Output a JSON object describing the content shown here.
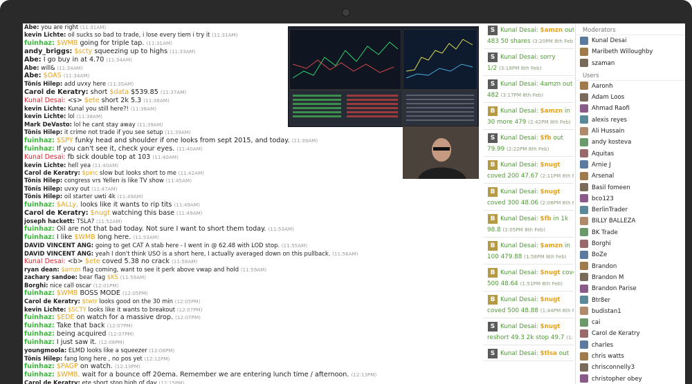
{
  "chat": [
    {
      "nick": "Abe:",
      "nc": "",
      "pre": "",
      "tk": "",
      "text": "you are right",
      "time": "(11:31AM)"
    },
    {
      "nick": "kevin Lichte:",
      "nc": "",
      "pre": "",
      "tk": "",
      "text": "oil sucks so bad to trade, i lose every tiem i try it",
      "time": "(11:31AM)"
    },
    {
      "nick": "fuinhaz:",
      "nc": "green",
      "pre": "",
      "tk": "$WMB",
      "text": "going for triple tap.",
      "time": "(11:31AM)",
      "big": true
    },
    {
      "nick": "andy_briggs:",
      "nc": "",
      "pre": "",
      "tk": "$scty",
      "text": "squeezing up to highs",
      "time": "(11:33AM)",
      "big": true
    },
    {
      "nick": "Abe:",
      "nc": "",
      "pre": "",
      "tk": "",
      "text": "I go buy in at 4.70",
      "time": "(11:34AM)",
      "big": true
    },
    {
      "nick": "Abe:",
      "nc": "",
      "pre": "",
      "tk": "",
      "text": "will&",
      "time": "(11:34AM)"
    },
    {
      "nick": "Abe:",
      "nc": "",
      "pre": "",
      "tk": "$OAS",
      "text": "",
      "time": "(11:34AM)",
      "big": true
    },
    {
      "nick": "Tõnis Hilep:",
      "nc": "",
      "pre": "",
      "tk": "",
      "text": "add uvxy here",
      "time": "(11:35AM)"
    },
    {
      "nick": "Carol de Keratry:",
      "nc": "",
      "pre": "short",
      "tk": "$data",
      "text": "$539.85",
      "time": "(11:37AM)",
      "big": true
    },
    {
      "nick": "Kunal Desai:",
      "nc": "red",
      "pre": "<s>",
      "tk": "$ete",
      "text": "short 2k 5.3",
      "time": "(11:38AM)",
      "big": true
    },
    {
      "nick": "kevin Lichte:",
      "nc": "",
      "pre": "",
      "tk": "",
      "text": "Kunal you still here?!",
      "time": "(11:38AM)"
    },
    {
      "nick": "kevin Lichte:",
      "nc": "",
      "pre": "",
      "tk": "",
      "text": "lol",
      "time": "(11:38AM)"
    },
    {
      "nick": "Mark DeVasto:",
      "nc": "",
      "pre": "",
      "tk": "",
      "text": "lol he cant stay away",
      "time": "(11:39AM)"
    },
    {
      "nick": "Tõnis Hilep:",
      "nc": "",
      "pre": "",
      "tk": "",
      "text": "it crime not trade if you see setup",
      "time": "(11:39AM)"
    },
    {
      "nick": "fuinhaz:",
      "nc": "green",
      "pre": "",
      "tk": "$SPY",
      "text": "funky head and shoulder if one looks from sept 2015, and today.",
      "time": "(11:39AM)",
      "big": true
    },
    {
      "nick": "fuinhaz:",
      "nc": "green",
      "pre": "",
      "tk": "",
      "text": "If you can't see it, check your eyes.",
      "time": "(11:40AM)",
      "big": true
    },
    {
      "nick": "Kunal Desai:",
      "nc": "red",
      "pre": "",
      "tk": "",
      "text": "fb sick double top at 103",
      "time": "(11:40AM)",
      "big": true
    },
    {
      "nick": "kevin Lichte:",
      "nc": "",
      "pre": "",
      "tk": "",
      "text": "hell yea",
      "time": "(11:40AM)"
    },
    {
      "nick": "Carol de Keratry:",
      "nc": "",
      "pre": "",
      "tk": "$pinc",
      "text": "slow but looks short to me",
      "time": "(11:42AM)"
    },
    {
      "nick": "Tõnis Hilep:",
      "nc": "",
      "pre": "",
      "tk": "",
      "text": "congress vrs Yellen is like TV show",
      "time": "(11:45AM)"
    },
    {
      "nick": "Tõnis Hilep:",
      "nc": "",
      "pre": "",
      "tk": "",
      "text": "uvxy out",
      "time": "(11:47AM)"
    },
    {
      "nick": "Tõnis Hilep:",
      "nc": "",
      "pre": "",
      "tk": "",
      "text": "oil starter uwti 4k",
      "time": "(11:49AM)"
    },
    {
      "nick": "fuinhaz:",
      "nc": "green",
      "pre": "",
      "tk": "$ALLy,",
      "text": "looks like it wants to rip tits",
      "time": "(11:49AM)",
      "big": true
    },
    {
      "nick": "Carol de Keratry:",
      "nc": "",
      "pre": "",
      "tk": "$nugt",
      "text": "watching this base",
      "time": "(11:49AM)",
      "big": true
    },
    {
      "nick": "joseph hackett:",
      "nc": "",
      "pre": "",
      "tk": "",
      "text": "TSLA?",
      "time": "(11:52AM)"
    },
    {
      "nick": "fuinhaz:",
      "nc": "green",
      "pre": "",
      "tk": "",
      "text": "Oil are not that bad today. Not sure I want to short them today.",
      "time": "(11:53AM)",
      "big": true
    },
    {
      "nick": "fuinhaz:",
      "nc": "green",
      "pre": "I like",
      "tk": "$WMB",
      "text": "long here.",
      "time": "(11:53AM)",
      "big": true
    },
    {
      "nick": "DAVID VINCENT ANG:",
      "nc": "",
      "pre": "",
      "tk": "",
      "text": "going to get CAT A stab here - I went in @ 62.48 with LOD stop.",
      "time": "(11:55AM)"
    },
    {
      "nick": "DAVID VINCENT ANG:",
      "nc": "",
      "pre": "",
      "tk": "",
      "text": "yeah I don't think USO is a short here, I actually averaged down on this pullback.",
      "time": "(11:56AM)"
    },
    {
      "nick": "Kunal Desai:",
      "nc": "red",
      "pre": "<b>",
      "tk": "$ete",
      "text": "coved 5.38 no crack",
      "time": "(11:58AM)",
      "big": true
    },
    {
      "nick": "ryan dean:",
      "nc": "",
      "pre": "",
      "tk": "$amzn",
      "text": "flag coming, want to see it perk above vwap and hold",
      "time": "(11:59AM)"
    },
    {
      "nick": "zachary sandoe:",
      "nc": "",
      "pre": "bear flag",
      "tk": "$KS",
      "text": "",
      "time": "(11:59AM)"
    },
    {
      "nick": "Borghi:",
      "nc": "",
      "pre": "",
      "tk": "",
      "text": "nice call oscar",
      "time": "(12:01PM)"
    },
    {
      "nick": "fuinhaz:",
      "nc": "green",
      "pre": "",
      "tk": "$WMB",
      "text": "BOSS MODE",
      "time": "(12:05PM)",
      "big": true
    },
    {
      "nick": "Carol de Keratry:",
      "nc": "",
      "pre": "",
      "tk": "$twtr",
      "text": "looks good on the 30 min",
      "time": "(12:05PM)"
    },
    {
      "nick": "kevin Lichte:",
      "nc": "",
      "pre": "",
      "tk": "$SCTY",
      "text": "looks like it wants to breakout",
      "time": "(12:07PM)"
    },
    {
      "nick": "fuinhaz:",
      "nc": "green",
      "pre": "",
      "tk": "$EDE",
      "text": "on watch for a massive drop.",
      "time": "(12:07PM)",
      "big": true
    },
    {
      "nick": "fuinhaz:",
      "nc": "green",
      "pre": "",
      "tk": "",
      "text": "Take that back",
      "time": "(12:07PM)",
      "big": true
    },
    {
      "nick": "fuinhaz:",
      "nc": "green",
      "pre": "",
      "tk": "",
      "text": "being acquired",
      "time": "(12:07PM)",
      "big": true
    },
    {
      "nick": "fuinhaz:",
      "nc": "green",
      "pre": "",
      "tk": "",
      "text": "I just saw it.",
      "time": "(12:08PM)",
      "big": true
    },
    {
      "nick": "youngmoola:",
      "nc": "",
      "pre": "",
      "tk": "",
      "text": "ELMD looks like a squeezer",
      "time": "(12:08PM)"
    },
    {
      "nick": "Tõnis Hilep:",
      "nc": "",
      "pre": "",
      "tk": "",
      "text": "fang long here , no pos yet",
      "time": "(12:12PM)"
    },
    {
      "nick": "fuinhaz:",
      "nc": "green",
      "pre": "",
      "tk": "$PAGP",
      "text": "on watch.",
      "time": "(12:13PM)",
      "big": true
    },
    {
      "nick": "fuinhaz:",
      "nc": "green",
      "pre": "",
      "tk": "$WMB,",
      "text": "wait for a bounce off 20ema. Remember we are entering lunch time / afternoon.",
      "time": "(12:13PM)",
      "big": true
    },
    {
      "nick": "Carol de Keratry:",
      "nc": "",
      "pre": "",
      "tk": "",
      "text": "ete short stop high of day",
      "time": "(12:15PM)"
    }
  ],
  "alerts": [
    {
      "av": "S",
      "ac": "s",
      "who": "Kunal Desai:",
      "tk": "$amzn",
      "tail": "out",
      "l2": "483 50 shares",
      "time": "(3:20PM 8th Feb)"
    },
    {
      "av": "S",
      "ac": "s",
      "who": "Kunal Desai:",
      "tk": "",
      "tail": "sorry",
      "l2": "1/2",
      "time": "(3:18PM 8th Feb)"
    },
    {
      "av": "S",
      "ac": "s",
      "who": "Kunal Desai:",
      "tk": "",
      "tail": "4amzn out",
      "l2": "482",
      "time": "(3:17PM 8th Feb)"
    },
    {
      "av": "B",
      "ac": "b",
      "who": "Kunal Desai:",
      "tk": "$amzn",
      "tail": "in",
      "l2": "30 more 479",
      "time": "(2:42PM 8th Feb)"
    },
    {
      "av": "S",
      "ac": "s",
      "who": "Kunal Desai:",
      "tk": "$fb",
      "tail": "out",
      "l2": "79.99",
      "time": "(2:22PM 8th Feb)"
    },
    {
      "av": "B",
      "ac": "b",
      "who": "Kunal Desai:",
      "tk": "$nugt",
      "tail": "",
      "l2": "coved 200 47.67",
      "time": "(2:11PM 8th Feb)"
    },
    {
      "av": "B",
      "ac": "b",
      "who": "Kunal Desai:",
      "tk": "$nugt",
      "tail": "",
      "l2": "coved 300 48.06",
      "time": "(2:08PM 8th Feb)"
    },
    {
      "av": "B",
      "ac": "b",
      "who": "Kunal Desai:",
      "tk": "$fb",
      "tail": "in 1k",
      "l2": "98.8",
      "time": "(2:05PM 8th Feb)"
    },
    {
      "av": "B",
      "ac": "b",
      "who": "Kunal Desai:",
      "tk": "$amzn",
      "tail": "in",
      "l2": "100 479.88",
      "time": "(1:58PM 8th Feb)"
    },
    {
      "av": "B",
      "ac": "b",
      "who": "Kunal Desai:",
      "tk": "$nugt",
      "tail": "cove",
      "l2": "500 48.64",
      "time": "(1:51PM 8th Feb)"
    },
    {
      "av": "B",
      "ac": "b",
      "who": "Kunal Desai:",
      "tk": "$nugt",
      "tail": "",
      "l2": "coved 500 48.88",
      "time": "(1:44PM 8th Feb)"
    },
    {
      "av": "S",
      "ac": "s",
      "who": "Kunal Desai:",
      "tk": "$nugt",
      "tail": "",
      "l2": "reshort 49.3 2k stop 49.7",
      "time": "(1:39PM 8th Feb)"
    },
    {
      "av": "S",
      "ac": "s",
      "who": "Kunal Desai:",
      "tk": "$tlsa",
      "tail": "out",
      "l2": "",
      "time": ""
    }
  ],
  "moderators_label": "Moderators",
  "moderators": [
    "Kunal Desai",
    "Maribeth Willoughby",
    "szaman"
  ],
  "users_label": "Users",
  "users": [
    "Aaronh",
    "Adam Loos",
    "Ahmad Raofi",
    "alexis reyes",
    "Ali Hussain",
    "andy kosteva",
    "Aquitas",
    "Arnie J",
    "Arsenal",
    "Basil fomeen",
    "bco123",
    "BerlinTrader",
    "BILLY BALLEZA",
    "BK Trade",
    "Borghi",
    "BoZe",
    "Brandon",
    "Brandon M",
    "Brandon Parise",
    "Btr8er",
    "budistan1",
    "cai",
    "Carol de Keratry",
    "charles",
    "chris watts",
    "chrisconnelly3",
    "christopher obey"
  ],
  "colors": {
    "nick_green": "#3cb43c",
    "nick_red": "#d9232d",
    "ticker": "#e8a317",
    "alert_green": "#4a9b2f"
  }
}
